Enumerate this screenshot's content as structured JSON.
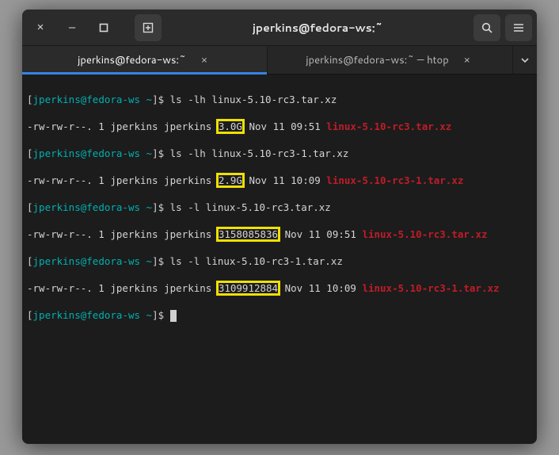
{
  "window": {
    "title": "jperkins@fedora-ws:~"
  },
  "tabs": {
    "active": {
      "label": "jperkins@fedora-ws:~"
    },
    "inactive": {
      "label": "jperkins@fedora-ws:~ — htop"
    }
  },
  "prompt": {
    "userhost": "jperkins@fedora-ws",
    "cwd": "~",
    "sep1": "[",
    "sep2": " ",
    "sep3": "]$ "
  },
  "lines": [
    {
      "cmd": "ls -lh linux-5.10-rc3.tar.xz"
    },
    {
      "perm": "-rw-rw-r--. 1 jperkins jperkins ",
      "size": "3.0G",
      "rest": " Nov 11 09:51 ",
      "file": "linux-5.10-rc3.tar.xz"
    },
    {
      "cmd": "ls -lh linux-5.10-rc3-1.tar.xz"
    },
    {
      "perm": "-rw-rw-r--. 1 jperkins jperkins ",
      "size": "2.9G",
      "rest": " Nov 11 10:09 ",
      "file": "linux-5.10-rc3-1.tar.xz"
    },
    {
      "cmd": "ls -l linux-5.10-rc3.tar.xz"
    },
    {
      "perm": "-rw-rw-r--. 1 jperkins jperkins ",
      "size": "3158085836",
      "rest": " Nov 11 09:51 ",
      "file": "linux-5.10-rc3.tar.xz"
    },
    {
      "cmd": "ls -l linux-5.10-rc3-1.tar.xz"
    },
    {
      "perm": "-rw-rw-r--. 1 jperkins jperkins ",
      "size": "3109912884",
      "rest": " Nov 11 10:09 ",
      "file": "linux-5.10-rc3-1.tar.xz"
    }
  ],
  "icons": {
    "close": "×",
    "minimize": "–"
  }
}
